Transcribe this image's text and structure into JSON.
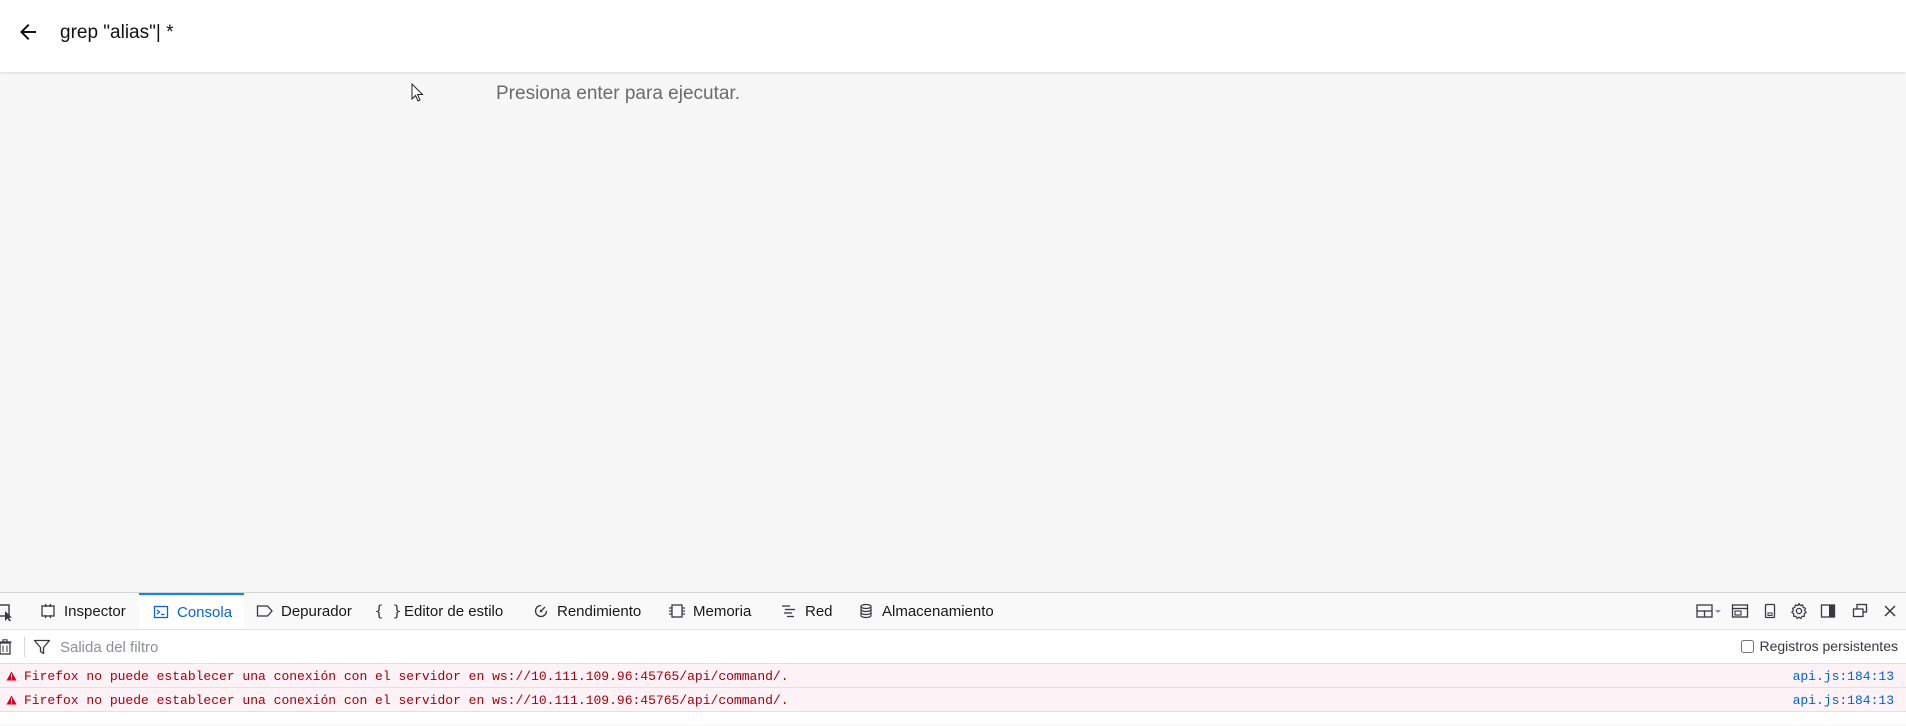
{
  "topbar": {
    "back_icon": "arrow-left-icon",
    "command_value": "grep \"alias\"| *"
  },
  "main": {
    "hint": "Presiona enter para ejecutar."
  },
  "devtools": {
    "tabs": [
      {
        "label": "Inspector",
        "icon": "inspector-icon"
      },
      {
        "label": "Consola",
        "icon": "console-icon",
        "active": true
      },
      {
        "label": "Depurador",
        "icon": "debugger-icon"
      },
      {
        "label": "Editor de estilo",
        "icon": "braces-icon"
      },
      {
        "label": "Rendimiento",
        "icon": "performance-icon"
      },
      {
        "label": "Memoria",
        "icon": "memory-icon"
      },
      {
        "label": "Red",
        "icon": "network-icon"
      },
      {
        "label": "Almacenamiento",
        "icon": "storage-icon"
      }
    ],
    "filter_placeholder": "Salida del filtro",
    "persist_label": "Registros persistentes",
    "messages": [
      {
        "text": "Firefox no puede establecer una conexión con el servidor en ws://10.111.109.96:45765/api/command/.",
        "source": "api.js:184:13"
      },
      {
        "text": "Firefox no puede establecer una conexión con el servidor en ws://10.111.109.96:45765/api/command/.",
        "source": "api.js:184:13"
      }
    ],
    "colors": {
      "active_tab": "#0a63d6",
      "error_text": "#a4000f",
      "error_bg": "#fdf2f5",
      "link": "#0060df"
    }
  }
}
